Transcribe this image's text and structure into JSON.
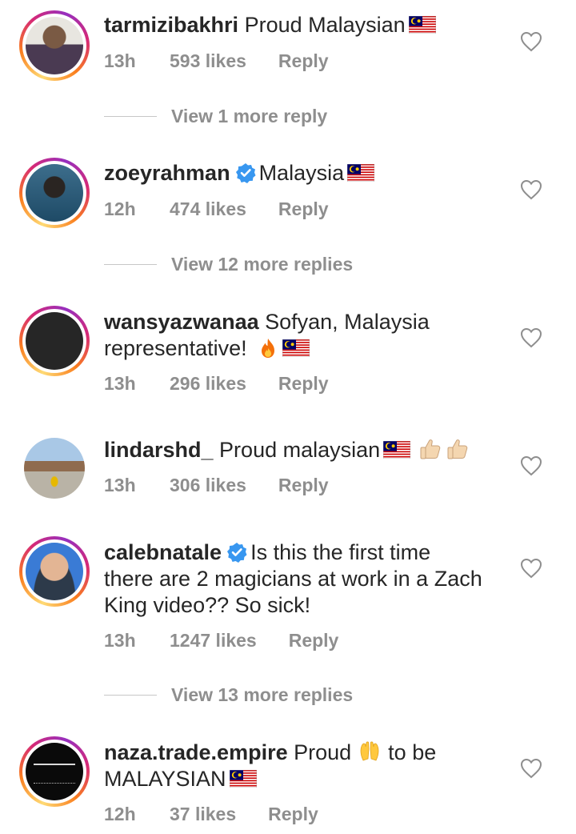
{
  "comments": [
    {
      "username": "tarmizibakhri",
      "verified": false,
      "text": "Proud Malaysian",
      "time": "13h",
      "likes": "593 likes",
      "reply_label": "Reply",
      "view_replies": "View 1 more reply"
    },
    {
      "username": "zoeyrahman",
      "verified": true,
      "text": "Malaysia",
      "time": "12h",
      "likes": "474 likes",
      "reply_label": "Reply",
      "view_replies": "View 12 more replies"
    },
    {
      "username": "wansyazwanaa",
      "verified": false,
      "text_line1": "Sofyan, Malaysia",
      "text_line2": "representative!",
      "time": "13h",
      "likes": "296 likes",
      "reply_label": "Reply"
    },
    {
      "username": "lindarshd_",
      "verified": false,
      "text": "Proud malaysian",
      "time": "13h",
      "likes": "306 likes",
      "reply_label": "Reply"
    },
    {
      "username": "calebnatale",
      "verified": true,
      "text_line1": "Is this the first time",
      "text_line2": "there are 2 magicians at work in a Zach",
      "text_line3": "King video?? So sick!",
      "time": "13h",
      "likes": "1247 likes",
      "reply_label": "Reply",
      "view_replies": "View 13 more replies"
    },
    {
      "username": "naza.trade.empire",
      "verified": false,
      "text_line1a": "Proud",
      "text_line1b": "to be",
      "text_line2": "MALAYSIAN",
      "time": "12h",
      "likes": "37 likes",
      "reply_label": "Reply"
    }
  ],
  "colors": {
    "text": "#262626",
    "secondary": "#8e8e8e",
    "verified": "#3897f0",
    "story_ring": "#d62976"
  }
}
